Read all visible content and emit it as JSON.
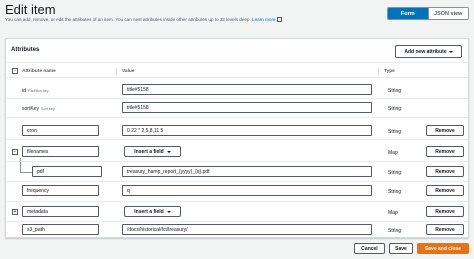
{
  "page": {
    "title": "Edit item",
    "subtitle": "You can add, remove, or edit the attributes of an item. You can nest attributes inside other attributes up to 32 levels deep.",
    "learn_more": "Learn more"
  },
  "view_toggle": {
    "form": "Form",
    "json": "JSON view",
    "selected": "Form"
  },
  "panel": {
    "title": "Attributes",
    "add_button": "Add new attribute"
  },
  "columns": {
    "name": "Attribute name",
    "value": "Value",
    "type": "Type"
  },
  "rows": [
    {
      "key": "id",
      "key_note": "Partition key",
      "value": "title#5158",
      "type": "String"
    },
    {
      "key": "sortKey",
      "key_note": "Sort key",
      "value": "title#5158",
      "type": "String"
    },
    {
      "key": "cron",
      "value": "0 22 * 2,5,8,11 5",
      "type": "String",
      "remove": "Remove"
    },
    {
      "key": "filenames",
      "insert": "Insert a field",
      "type": "Map",
      "remove": "Remove",
      "expander": "−"
    },
    {
      "key": "pdf",
      "value": "treasury_hamp_report_{yyyy}_{q}.pdf",
      "type": "String",
      "remove": "Remove"
    },
    {
      "key": "frequency",
      "value": "q",
      "type": "String",
      "remove": "Remove"
    },
    {
      "key": "metadata",
      "insert": "Insert a field",
      "type": "Map",
      "remove": "Remove",
      "expander": "+"
    },
    {
      "key": "s3_path",
      "value": "/docs/historical/fct/treasury/",
      "type": "String",
      "remove": "Remove"
    }
  ],
  "header_check": "−",
  "footer": {
    "cancel": "Cancel",
    "save": "Save",
    "save_close": "Save and close"
  }
}
